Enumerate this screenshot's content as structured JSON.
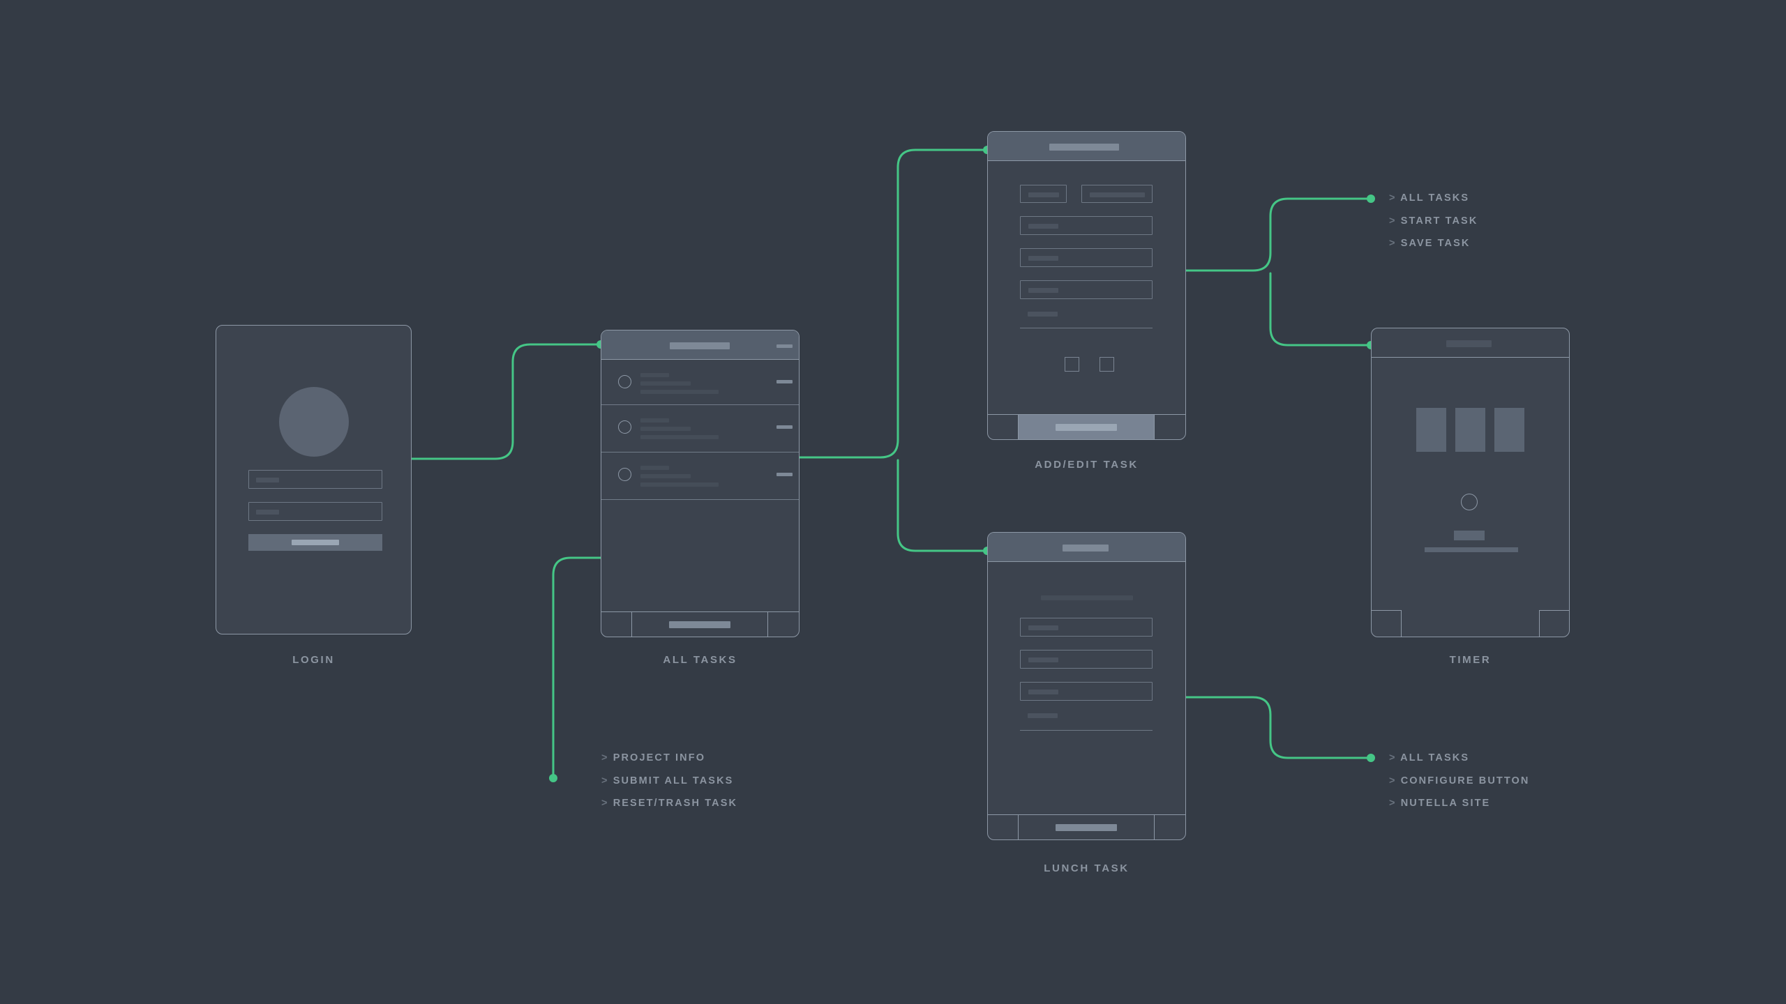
{
  "meta": {
    "background_color": "#343b45",
    "accent_color": "#45c686",
    "screen_fill": "#3c434e",
    "frame_stroke": "#8d98a6",
    "label_color": "#8c95a1"
  },
  "screens": [
    {
      "id": "login",
      "label": "LOGIN"
    },
    {
      "id": "alltasks",
      "label": "ALL TASKS"
    },
    {
      "id": "addedit",
      "label": "ADD/EDIT TASK"
    },
    {
      "id": "lunch",
      "label": "LUNCH TASK"
    },
    {
      "id": "timer",
      "label": "TIMER"
    }
  ],
  "note_groups": [
    {
      "id": "addedit-actions",
      "items": [
        {
          "caret": ">",
          "label": "ALL TASKS"
        },
        {
          "caret": ">",
          "label": "START TASK"
        },
        {
          "caret": ">",
          "label": "SAVE TASK"
        }
      ]
    },
    {
      "id": "timer-actions",
      "items": [
        {
          "caret": ">",
          "label": "ALL TASKS"
        },
        {
          "caret": ">",
          "label": "CONFIGURE BUTTON"
        },
        {
          "caret": ">",
          "label": "NUTELLA SITE"
        }
      ]
    },
    {
      "id": "alltasks-actions",
      "items": [
        {
          "caret": ">",
          "label": "PROJECT INFO"
        },
        {
          "caret": ">",
          "label": "SUBMIT ALL TASKS"
        },
        {
          "caret": ">",
          "label": "RESET/TRASH TASK"
        }
      ]
    }
  ],
  "flows": [
    {
      "from": "login",
      "to": "alltasks"
    },
    {
      "from": "alltasks",
      "to": "addedit"
    },
    {
      "from": "alltasks",
      "to": "lunch"
    },
    {
      "from": "alltasks",
      "to": "alltasks-actions"
    },
    {
      "from": "addedit",
      "to": "addedit-actions"
    },
    {
      "from": "addedit",
      "to": "timer"
    },
    {
      "from": "lunch",
      "to": "timer-actions"
    }
  ]
}
